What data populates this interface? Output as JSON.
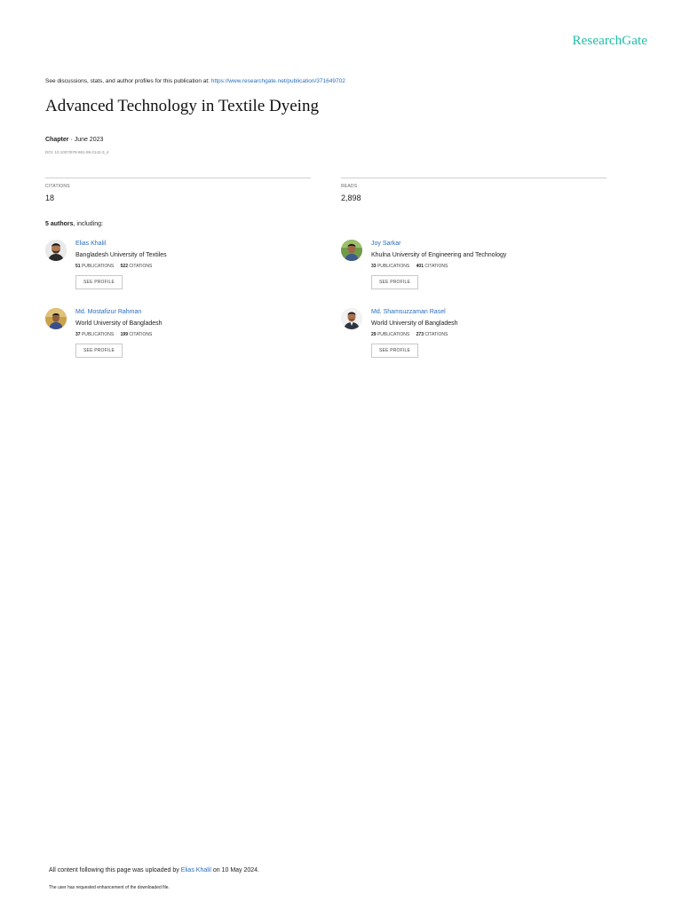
{
  "brand": {
    "logo_text": "ResearchGate",
    "accent_color": "#1cbfa6",
    "link_color": "#2a6ebb"
  },
  "header": {
    "see_discussions_text": "See discussions, stats, and author profiles for this publication at: ",
    "publication_url": "https://www.researchgate.net/publication/371649702"
  },
  "publication": {
    "title": "Advanced Technology in Textile Dyeing",
    "type": "Chapter",
    "separator": " · ",
    "date": "June 2023",
    "doi": "DOI: 10.1007/978-981-99-2142-3_4"
  },
  "stats": {
    "citations_label": "CITATIONS",
    "citations_value": "18",
    "reads_label": "READS",
    "reads_value": "2,898"
  },
  "authors_heading": {
    "count": "5 authors",
    "suffix": ", including:"
  },
  "authors": [
    {
      "name": "Elias Khalil",
      "institution": "Bangladesh University of Textiles",
      "publications": "51",
      "citations": "522",
      "avatar": "avatar-man-beard"
    },
    {
      "name": "Joy Sarkar",
      "institution": "Khulna University of Engineering and Technology",
      "publications": "33",
      "citations": "401",
      "avatar": "avatar-man-outdoor"
    },
    {
      "name": "Md. Mostafizur Rahman",
      "institution": "World University of Bangladesh",
      "publications": "37",
      "citations": "199",
      "avatar": "avatar-man-outdoor"
    },
    {
      "name": "Md. Shamsuzzaman Rasel",
      "institution": "World University of Bangladesh",
      "publications": "29",
      "citations": "273",
      "avatar": "avatar-man-formal"
    }
  ],
  "author_labels": {
    "publications_label": "PUBLICATIONS",
    "citations_label": "CITATIONS",
    "see_profile": "SEE PROFILE"
  },
  "footer": {
    "uploaded_prefix": "All content following this page was uploaded by ",
    "uploader": "Elias Khalil",
    "uploaded_suffix": " on 10 May 2024.",
    "enhancement_note": "The user has requested enhancement of the downloaded file."
  }
}
